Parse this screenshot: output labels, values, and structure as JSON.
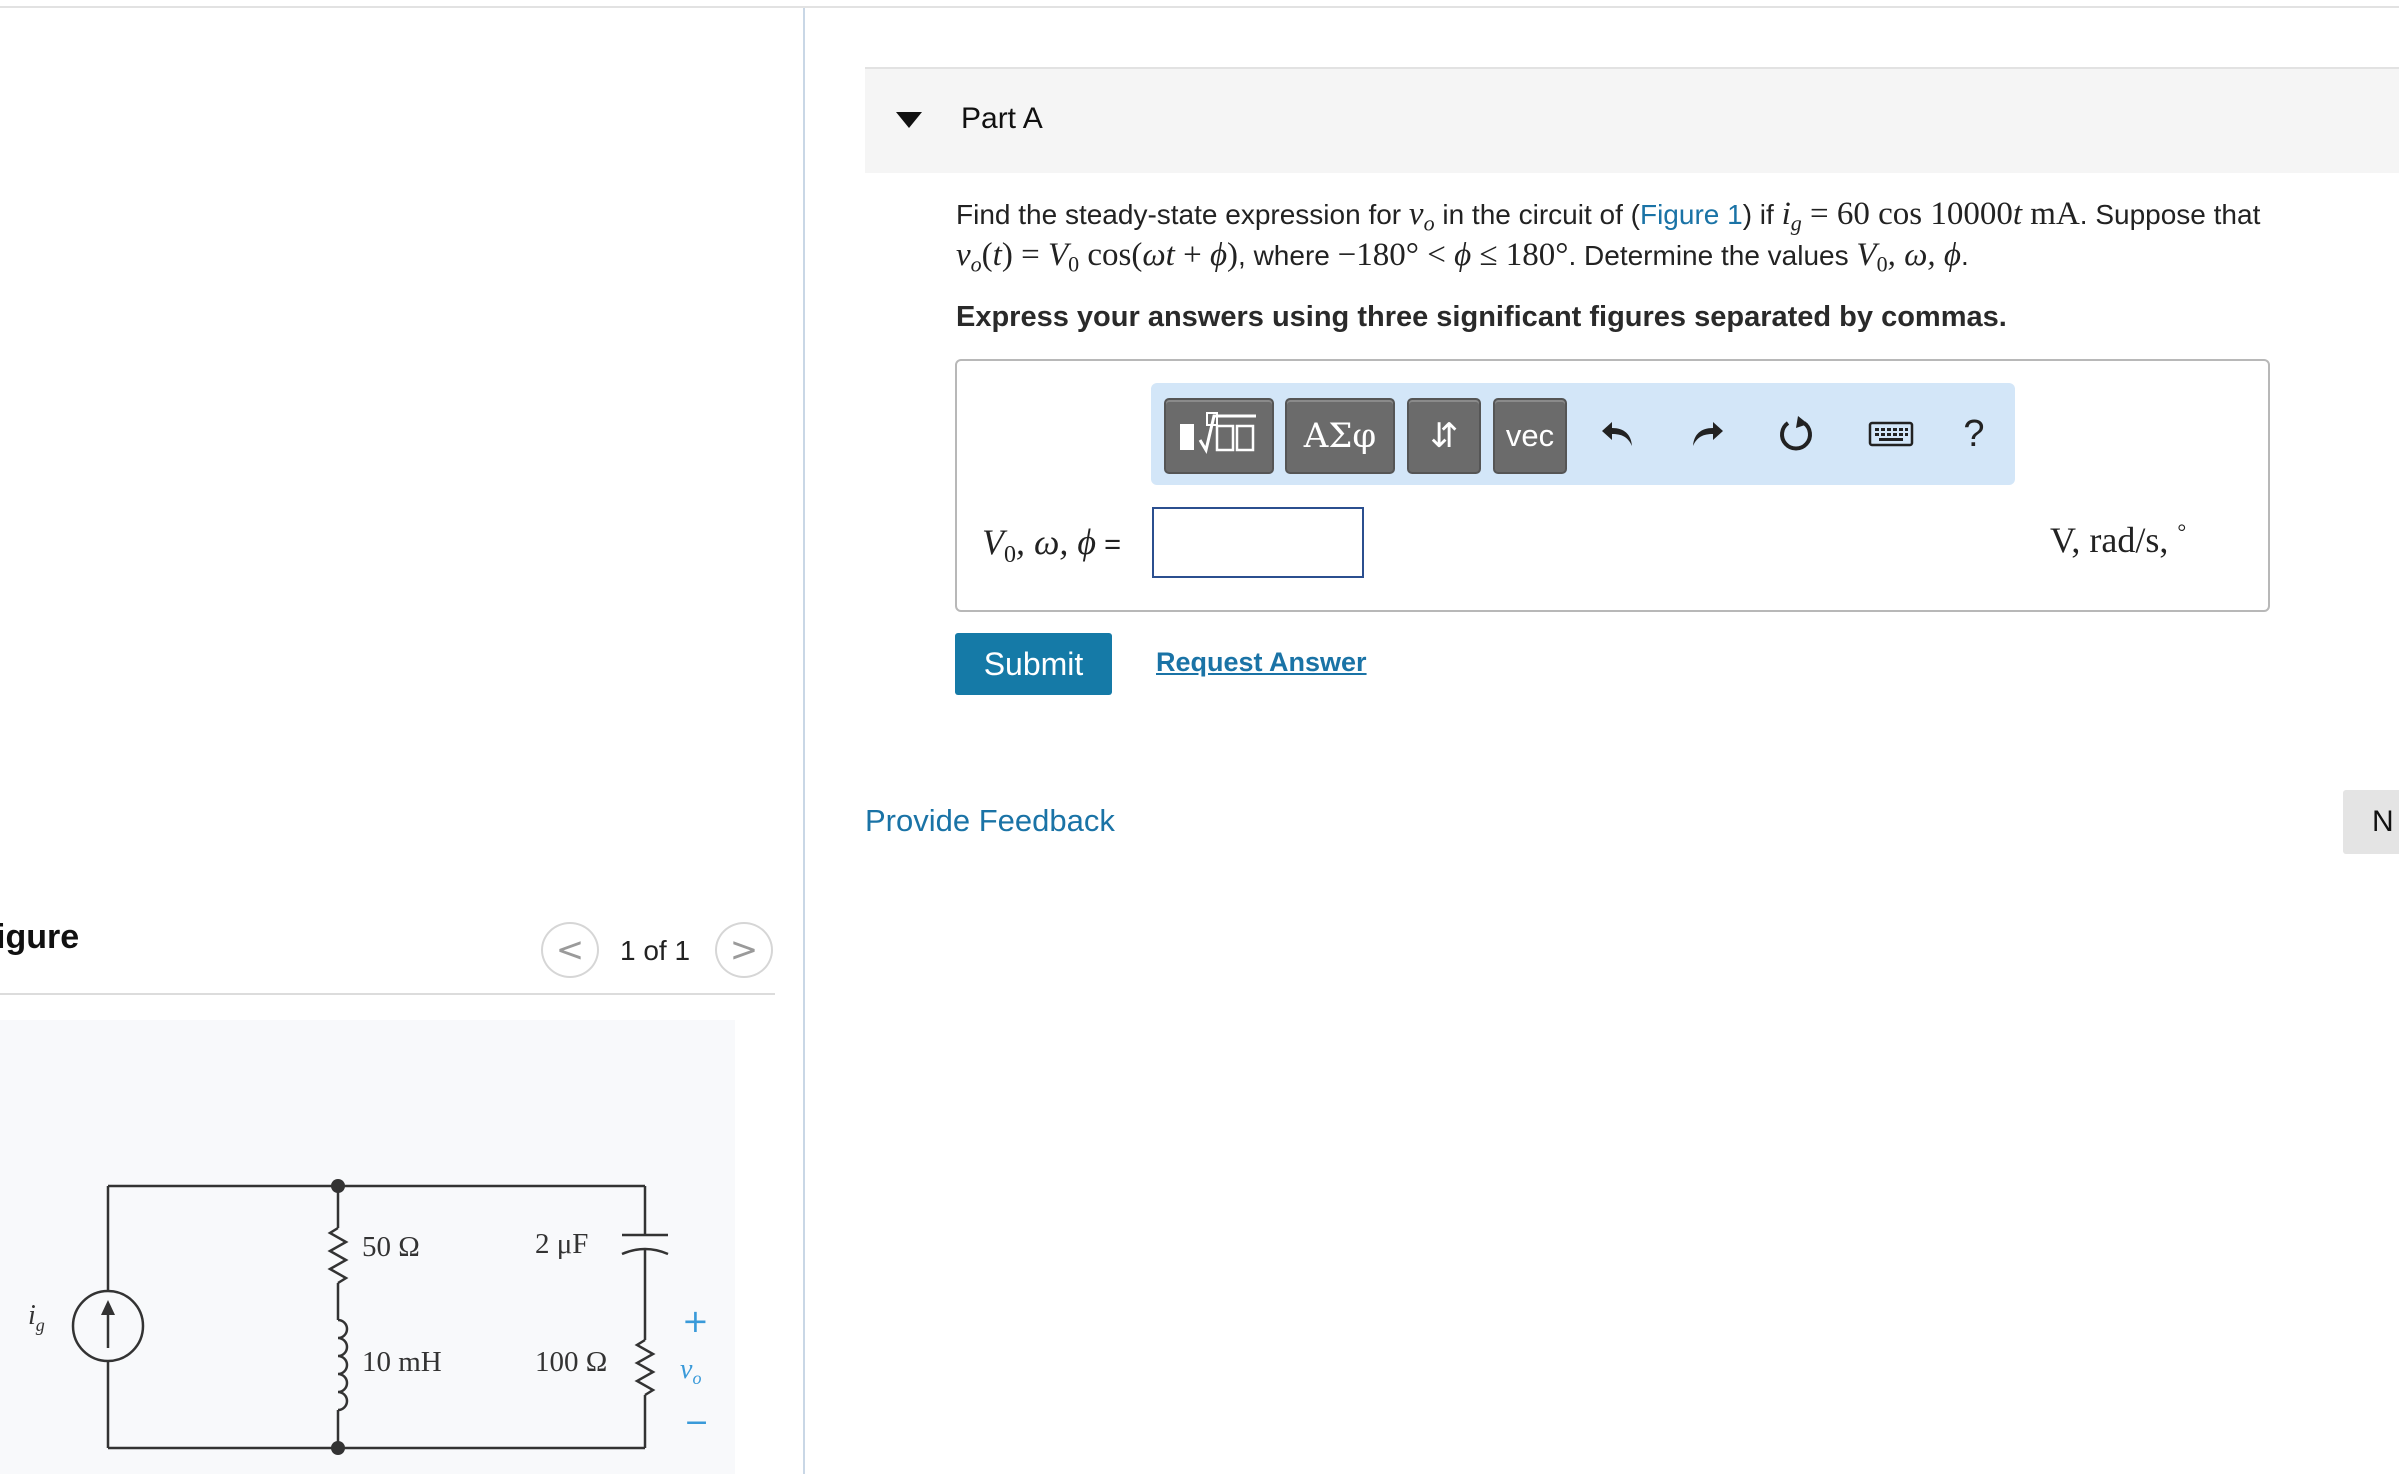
{
  "figure_panel": {
    "title": "igure",
    "counter": "1 of 1",
    "prev_symbol": "<",
    "next_symbol": ">",
    "circuit": {
      "source_label": "i",
      "source_subscript": "g",
      "r1": "50 Ω",
      "l1": "10 mH",
      "c1": "2 μF",
      "r2": "100 Ω",
      "plus": "+",
      "minus": "−",
      "vo": "v",
      "vo_subscript": "o"
    }
  },
  "part": {
    "title": "Part A"
  },
  "question": {
    "line1_a": "Find the steady-state expression for ",
    "vo": "v",
    "vo_sub": "o",
    "line1_b": " in the circuit of (",
    "figure_link": "Figure 1",
    "line1_c": ") if ",
    "ig": "i",
    "ig_sub": "g",
    "ig_eq": " = 60 cos 10000",
    "t": "t",
    "ig_unit": " mA",
    "line1_d": ". Suppose that",
    "line2_vot": "v",
    "line2_vot_sub": "o",
    "line2_expr_a": "(",
    "line2_expr_t": "t",
    "line2_expr_b": ") = ",
    "line2_V": "V",
    "line2_V_sub": "0",
    "line2_cos": " cos(",
    "line2_omega": "ωt",
    "line2_plus": " + ",
    "line2_phi": "ϕ",
    "line2_close": ")",
    "line2_where": ", where ",
    "line2_range_a": "−180° < ",
    "line2_range_phi": "ϕ",
    "line2_range_b": " ≤ 180°",
    "line2_det": ". Determine the values ",
    "line2_vals_V": "V",
    "line2_vals_V_sub": "0",
    "line2_vals_rest": ", ω, ϕ",
    "line2_end": ".",
    "instruction": "Express your answers using three significant figures separated by commas."
  },
  "toolbar": {
    "greek": "ΑΣφ",
    "arrows": "⇵",
    "vec": "vec",
    "help": "?",
    "icons": [
      "template-icon",
      "undo-icon",
      "redo-icon",
      "reset-icon",
      "keyboard-icon"
    ]
  },
  "answer": {
    "label_V": "V",
    "label_V_sub": "0",
    "label_rest": ", ω, ϕ",
    "label_eq": " =",
    "value": "",
    "units": "V, rad/s, ",
    "units_degree": "°"
  },
  "actions": {
    "submit": "Submit",
    "request_answer": "Request Answer",
    "provide_feedback": "Provide Feedback",
    "next": "N"
  },
  "colors": {
    "link": "#1a73a6",
    "submit_bg": "#157aa7",
    "toolbar_bg": "#d3e6f8",
    "toolbar_btn": "#6b6b6b"
  }
}
